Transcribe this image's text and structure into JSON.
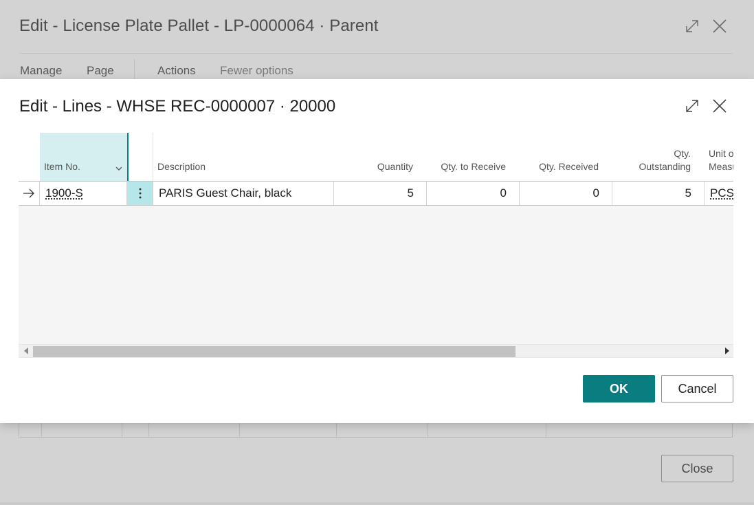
{
  "parent_dialog": {
    "title": "Edit - License Plate Pallet - LP-0000064 · Parent",
    "menu": [
      "Manage",
      "Page",
      "Actions",
      "Fewer options"
    ],
    "close_label": "Close"
  },
  "dialog": {
    "title": "Edit - Lines - WHSE REC-0000007 · 20000",
    "columns": {
      "item_no": "Item No.",
      "description": "Description",
      "quantity": "Quantity",
      "qty_to_receive": "Qty. to Receive",
      "qty_received": "Qty. Received",
      "qty_outstanding_1": "Qty.",
      "qty_outstanding_2": "Outstanding",
      "uom_1": "Unit of",
      "uom_2": "Measure"
    },
    "rows": [
      {
        "item_no": "1900-S",
        "description": "PARIS Guest Chair, black",
        "quantity": "5",
        "qty_to_receive": "0",
        "qty_received": "0",
        "qty_outstanding": "5",
        "uom": "PCS"
      }
    ],
    "ok_label": "OK",
    "cancel_label": "Cancel"
  },
  "icons": {
    "expand": "expand-icon",
    "close": "close-icon",
    "row_arrow": "arrow-right-icon",
    "row_menu": "more-vertical-icon",
    "sort": "chevron-down-icon"
  },
  "colors": {
    "accent": "#0a7d80",
    "selected_column": "#d5eff1",
    "row_menu_bg": "#b5e6ea",
    "overlay": "#d3d3d3"
  }
}
